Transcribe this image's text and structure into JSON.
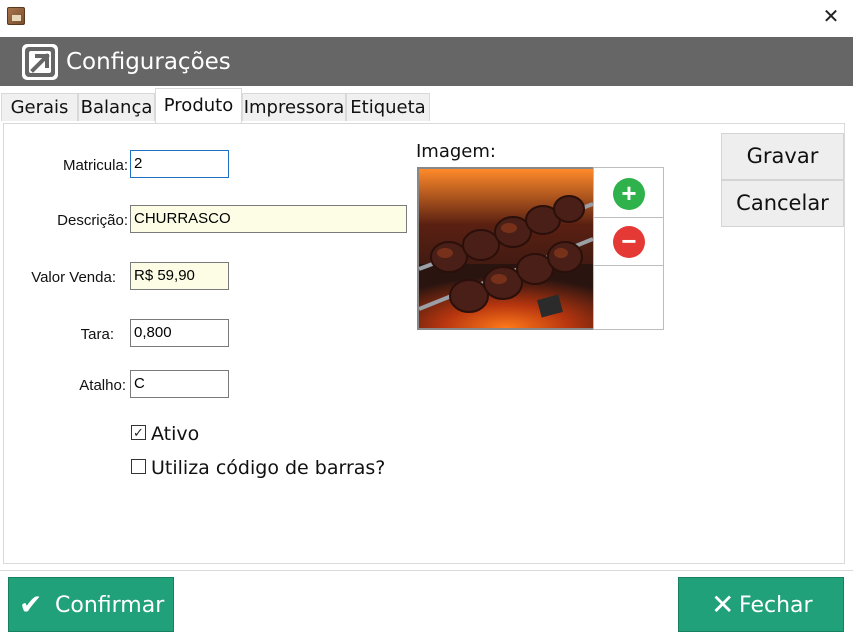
{
  "window": {
    "title_icon": "app-box-icon",
    "close_glyph": "✕"
  },
  "header": {
    "title": "Configurações",
    "logo": "arrow-up-right-icon",
    "bg": "#666666"
  },
  "tabs": [
    {
      "label": "Gerais",
      "active": false
    },
    {
      "label": "Balança",
      "active": false
    },
    {
      "label": "Produto",
      "active": true
    },
    {
      "label": "Impressora",
      "active": false
    },
    {
      "label": "Etiqueta",
      "active": false
    }
  ],
  "form": {
    "matricula": {
      "label": "Matricula:",
      "value": "2"
    },
    "descricao": {
      "label": "Descrição:",
      "value": "CHURRASCO"
    },
    "valor_venda": {
      "label": "Valor Venda:",
      "value": "R$ 59,90"
    },
    "tara": {
      "label": "Tara:",
      "value": "0,800"
    },
    "atalho": {
      "label": "Atalho:",
      "value": "C"
    },
    "ativo": {
      "label": "Ativo",
      "checked": true,
      "mark": "✓"
    },
    "codigo_barras": {
      "label": "Utiliza código de barras?",
      "checked": false
    }
  },
  "image": {
    "label": "Imagem:",
    "add_icon": "+",
    "remove_icon": "−"
  },
  "side_buttons": {
    "save": "Gravar",
    "cancel": "Cancelar"
  },
  "footer": {
    "confirm": {
      "label": "Confirmar",
      "icon": "✔"
    },
    "close": {
      "label": "Fechar",
      "icon": "✕"
    }
  },
  "colors": {
    "accent_green": "#21a179",
    "add_green": "#2fb24b",
    "remove_red": "#e53935"
  }
}
